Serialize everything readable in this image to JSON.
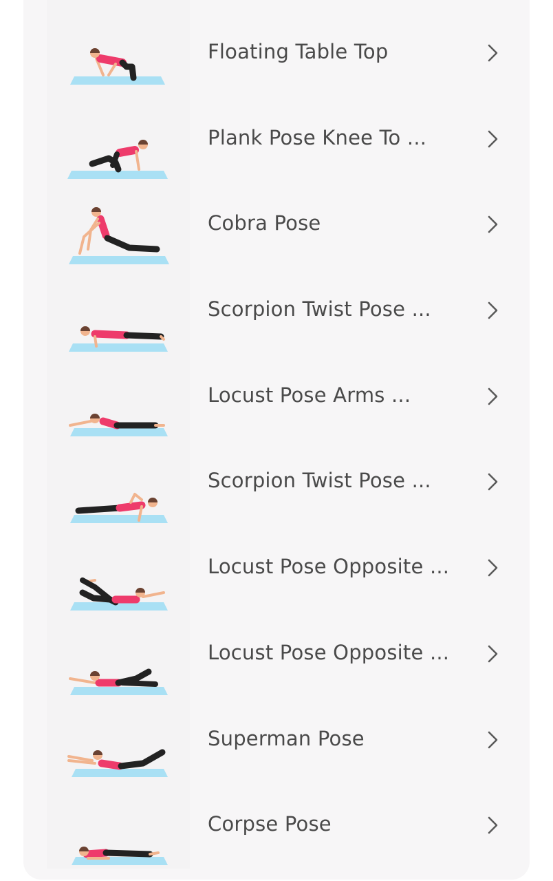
{
  "exercises": [
    {
      "label": "Floating Table Top",
      "thumb_icon": "floating-table-top-illustration"
    },
    {
      "label": "Plank Pose Knee To ...",
      "thumb_icon": "plank-knee-to-illustration"
    },
    {
      "label": "Cobra Pose",
      "thumb_icon": "cobra-pose-illustration"
    },
    {
      "label": "Scorpion Twist Pose ...",
      "thumb_icon": "scorpion-twist-illustration"
    },
    {
      "label": "Locust Pose Arms ...",
      "thumb_icon": "locust-arms-illustration"
    },
    {
      "label": "Scorpion Twist Pose ...",
      "thumb_icon": "scorpion-twist-2-illustration"
    },
    {
      "label": "Locust Pose Opposite ...",
      "thumb_icon": "locust-opposite-illustration"
    },
    {
      "label": "Locust Pose Opposite ...",
      "thumb_icon": "locust-opposite-2-illustration"
    },
    {
      "label": "Superman Pose",
      "thumb_icon": "superman-pose-illustration"
    },
    {
      "label": "Corpse Pose",
      "thumb_icon": "corpse-pose-illustration"
    }
  ],
  "colors": {
    "mat": "#a9e0f4",
    "top": "#ee3b6b",
    "pants": "#222222",
    "skin": "#f1b48e",
    "hair": "#6a4232",
    "text": "#4a4a4a",
    "chevron": "#5a5a5a"
  }
}
